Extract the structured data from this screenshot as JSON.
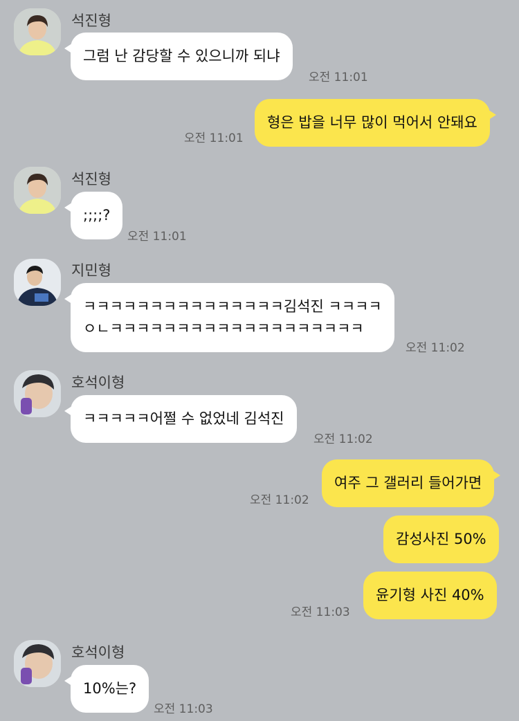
{
  "colors": {
    "background": "#b9bcc0",
    "incoming": "#ffffff",
    "outgoing": "#fbe54d"
  },
  "messages": [
    {
      "from": "석진형",
      "text": "그럼 난 감당할 수 있으니까 되냐",
      "time": "오전 11:01"
    },
    {
      "from": "me",
      "text": "형은 밥을 너무 많이 먹어서 안돼요",
      "time": "오전 11:01"
    },
    {
      "from": "석진형",
      "text": ";;;;?",
      "time": "오전 11:01"
    },
    {
      "from": "지민형",
      "line1": "ㅋㅋㅋㅋㅋㅋㅋㅋㅋㅋㅋㅋㅋㅋㅋ김석진 ㅋㅋㅋㅋ",
      "line2": "ㅇㄴㅋㅋㅋㅋㅋㅋㅋㅋㅋㅋㅋㅋㅋㅋㅋㅋㅋㅋㅋ",
      "time": "오전 11:02"
    },
    {
      "from": "호석이형",
      "text": "ㅋㅋㅋㅋㅋ어쩔 수 없었네 김석진",
      "time": "오전 11:02"
    },
    {
      "from": "me",
      "text": "여주 그 갤러리 들어가면",
      "time": "오전 11:02"
    },
    {
      "from": "me",
      "text": "감성사진 50%",
      "time": ""
    },
    {
      "from": "me",
      "text": "윤기형 사진 40%",
      "time": "오전 11:03"
    },
    {
      "from": "호석이형",
      "text": "10%는?",
      "time": "오전 11:03"
    }
  ]
}
